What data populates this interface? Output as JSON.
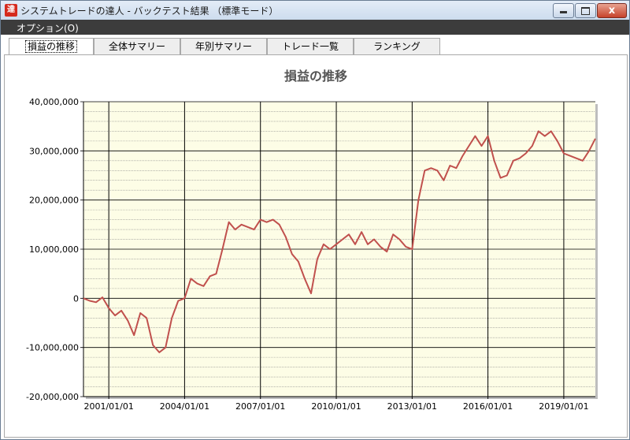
{
  "window": {
    "title": "システムトレードの達人 - バックテスト結果 （標準モード）",
    "app_icon_text": "達",
    "close_glyph": "x"
  },
  "menu": {
    "options_label": "オプション(O)"
  },
  "tabs": [
    {
      "label": "損益の推移",
      "active": true
    },
    {
      "label": "全体サマリー",
      "active": false
    },
    {
      "label": "年別サマリー",
      "active": false
    },
    {
      "label": "トレード一覧",
      "active": false
    },
    {
      "label": "ランキング",
      "active": false
    }
  ],
  "colors": {
    "plot_background": "#fdfde6",
    "line": "#c0504d",
    "major_grid": "#000000",
    "minor_grid": "#888888",
    "title": "#555555"
  },
  "chart_data": {
    "type": "line",
    "title": "損益の推移",
    "xlabel": "",
    "ylabel": "",
    "ylim": [
      -20000000,
      40000000
    ],
    "y_ticks": [
      {
        "value": 40000000,
        "label": "40,000,000"
      },
      {
        "value": 30000000,
        "label": "30,000,000"
      },
      {
        "value": 20000000,
        "label": "20,000,000"
      },
      {
        "value": 10000000,
        "label": "10,000,000"
      },
      {
        "value": 0,
        "label": "0"
      },
      {
        "value": -10000000,
        "label": "-10,000,000"
      },
      {
        "value": -20000000,
        "label": "-20,000,000"
      }
    ],
    "xlim": [
      "2000/01/01",
      "2020/04/01"
    ],
    "x_ticks": [
      {
        "value": "2001/01/01",
        "label": "2001/01/01"
      },
      {
        "value": "2004/01/01",
        "label": "2004/01/01"
      },
      {
        "value": "2007/01/01",
        "label": "2007/01/01"
      },
      {
        "value": "2010/01/01",
        "label": "2010/01/01"
      },
      {
        "value": "2013/01/01",
        "label": "2013/01/01"
      },
      {
        "value": "2016/01/01",
        "label": "2016/01/01"
      },
      {
        "value": "2019/01/01",
        "label": "2019/01/01"
      }
    ],
    "grid": true,
    "series": [
      {
        "x": [
          "2000/01/01",
          "2000/04/01",
          "2000/07/01",
          "2000/10/01",
          "2001/01/01",
          "2001/04/01",
          "2001/07/01",
          "2001/10/01",
          "2002/01/01",
          "2002/04/01",
          "2002/07/01",
          "2002/10/01",
          "2003/01/01",
          "2003/04/01",
          "2003/07/01",
          "2003/10/01",
          "2004/01/01",
          "2004/04/01",
          "2004/07/01",
          "2004/10/01",
          "2005/01/01",
          "2005/04/01",
          "2005/07/01",
          "2005/10/01",
          "2006/01/01",
          "2006/04/01",
          "2006/07/01",
          "2006/10/01",
          "2007/01/01",
          "2007/04/01",
          "2007/07/01",
          "2007/10/01",
          "2008/01/01",
          "2008/04/01",
          "2008/07/01",
          "2008/10/01",
          "2009/01/01",
          "2009/04/01",
          "2009/07/01",
          "2009/10/01",
          "2010/01/01",
          "2010/04/01",
          "2010/07/01",
          "2010/10/01",
          "2011/01/01",
          "2011/04/01",
          "2011/07/01",
          "2011/10/01",
          "2012/01/01",
          "2012/04/01",
          "2012/07/01",
          "2012/10/01",
          "2013/01/01",
          "2013/04/01",
          "2013/07/01",
          "2013/10/01",
          "2014/01/01",
          "2014/04/01",
          "2014/07/01",
          "2014/10/01",
          "2015/01/01",
          "2015/04/01",
          "2015/07/01",
          "2015/10/01",
          "2016/01/01",
          "2016/04/01",
          "2016/07/01",
          "2016/10/01",
          "2017/01/01",
          "2017/04/01",
          "2017/07/01",
          "2017/10/01",
          "2018/01/01",
          "2018/04/01",
          "2018/07/01",
          "2018/10/01",
          "2019/01/01",
          "2019/04/01",
          "2019/07/01",
          "2019/10/01",
          "2020/01/01",
          "2020/04/01"
        ],
        "values": [
          0,
          -500000,
          -800000,
          200000,
          -2000000,
          -3500000,
          -2500000,
          -4500000,
          -7500000,
          -3000000,
          -4000000,
          -9500000,
          -11000000,
          -10000000,
          -4000000,
          -500000,
          0,
          4000000,
          3000000,
          2500000,
          4500000,
          5000000,
          10000000,
          15500000,
          14000000,
          15000000,
          14500000,
          14000000,
          16000000,
          15500000,
          16000000,
          15000000,
          12500000,
          9000000,
          7500000,
          4000000,
          1000000,
          8000000,
          11000000,
          10000000,
          11000000,
          12000000,
          13000000,
          11000000,
          13500000,
          11000000,
          12000000,
          10500000,
          9500000,
          13000000,
          12000000,
          10500000,
          10000000,
          20000000,
          26000000,
          26500000,
          26000000,
          24000000,
          27000000,
          26500000,
          29000000,
          31000000,
          33000000,
          31000000,
          33000000,
          28000000,
          24500000,
          25000000,
          28000000,
          28500000,
          29500000,
          31000000,
          34000000,
          33000000,
          34000000,
          32000000,
          29500000,
          29000000,
          28500000,
          28000000,
          30000000,
          32500000
        ]
      }
    ]
  }
}
